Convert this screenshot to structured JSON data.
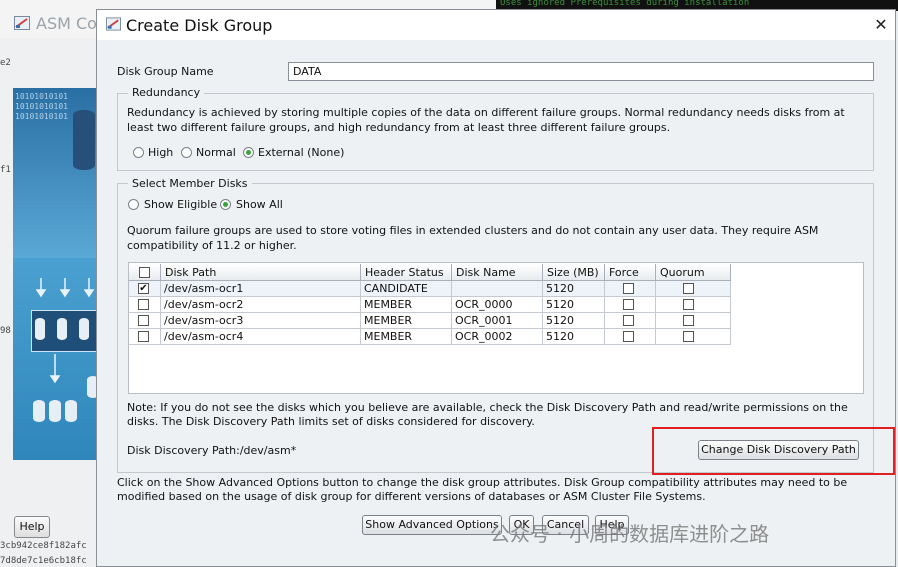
{
  "background_window": {
    "title": "ASM Co",
    "help_label": "Help",
    "fragments": [
      "e2",
      "f1",
      "98",
      "3cb942ce8f182afc",
      "7d8de7c1e6cb18fc"
    ],
    "art_bits": "10101010101\n10101010101\n10101010101"
  },
  "terminal": {
    "text": "Uses ignored Prerequisites during installation"
  },
  "dialog": {
    "title": "Create Disk Group",
    "close_glyph": "✕",
    "disk_group_name_label": "Disk Group Name",
    "disk_group_name_value": "DATA",
    "redundancy": {
      "title": "Redundancy",
      "description": "Redundancy is achieved by storing multiple copies of the data on different failure groups. Normal redundancy needs disks from at least two different failure groups, and high redundancy from at least three different failure groups.",
      "options": [
        {
          "label": "High",
          "selected": false
        },
        {
          "label": "Normal",
          "selected": false
        },
        {
          "label": "External (None)",
          "selected": true
        }
      ]
    },
    "member_disks": {
      "title": "Select Member Disks",
      "filters": [
        {
          "label": "Show Eligible",
          "selected": false
        },
        {
          "label": "Show All",
          "selected": true
        }
      ],
      "quorum_note": "Quorum failure groups are used to store voting files in extended clusters and do not contain any user data. They require ASM compatibility of 11.2 or higher.",
      "columns": [
        "",
        "Disk Path",
        "Header Status",
        "Disk Name",
        "Size (MB)",
        "Force",
        "Quorum"
      ],
      "rows": [
        {
          "checked": true,
          "path": "/dev/asm-ocr1",
          "status": "CANDIDATE",
          "name": "",
          "size": "5120",
          "force": false,
          "quorum": false
        },
        {
          "checked": false,
          "path": "/dev/asm-ocr2",
          "status": "MEMBER",
          "name": "OCR_0000",
          "size": "5120",
          "force": false,
          "quorum": false
        },
        {
          "checked": false,
          "path": "/dev/asm-ocr3",
          "status": "MEMBER",
          "name": "OCR_0001",
          "size": "5120",
          "force": false,
          "quorum": false
        },
        {
          "checked": false,
          "path": "/dev/asm-ocr4",
          "status": "MEMBER",
          "name": "OCR_0002",
          "size": "5120",
          "force": false,
          "quorum": false
        }
      ],
      "discovery_note": "Note: If you do not see the disks which you believe are available, check the Disk Discovery Path and read/write permissions on the disks. The Disk Discovery Path limits set of disks considered for discovery.",
      "discovery_path_label": "Disk Discovery Path:/dev/asm*",
      "change_path_button": "Change Disk Discovery Path"
    },
    "advanced_note": "Click on the Show Advanced Options button to change the disk group attributes. Disk Group compatibility attributes may need to be modified based on the usage of disk group for different versions of databases or ASM Cluster File Systems.",
    "buttons": {
      "advanced": "Show Advanced Options",
      "ok": "OK",
      "cancel": "Cancel",
      "help": "Help"
    },
    "highlight_color": "#e02020"
  },
  "watermark": "公众号 · 小周的数据库进阶之路"
}
